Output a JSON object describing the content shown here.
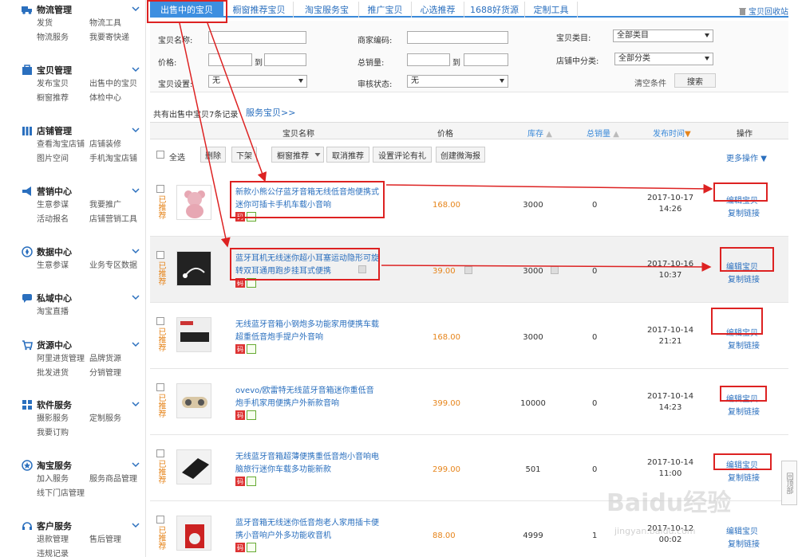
{
  "sidebar": {
    "sections": [
      {
        "title": "物流管理",
        "icon": "truck-icon",
        "links": [
          "发货",
          "物流工具",
          "物流服务",
          "我要寄快递"
        ]
      },
      {
        "title": "宝贝管理",
        "icon": "box-icon",
        "links": [
          "发布宝贝",
          "出售中的宝贝",
          "橱窗推荐",
          "体检中心"
        ]
      },
      {
        "title": "店铺管理",
        "icon": "store-icon",
        "links": [
          "查看淘宝店铺",
          "店铺装修",
          "图片空间",
          "手机淘宝店铺"
        ]
      },
      {
        "title": "营销中心",
        "icon": "megaphone-icon",
        "links": [
          "生意参谋",
          "我要推广",
          "活动报名",
          "店铺营销工具"
        ]
      },
      {
        "title": "数据中心",
        "icon": "compass-icon",
        "links": [
          "生意参谋",
          "业务专区数据"
        ]
      },
      {
        "title": "私域中心",
        "icon": "chat-icon",
        "links": [
          "淘宝直播"
        ]
      },
      {
        "title": "货源中心",
        "icon": "cart-icon",
        "links": [
          "阿里进货管理",
          "品牌货源",
          "批发进货",
          "分销管理"
        ]
      },
      {
        "title": "软件服务",
        "icon": "grid-icon",
        "links": [
          "摄影服务",
          "定制服务",
          "我要订购"
        ]
      },
      {
        "title": "淘宝服务",
        "icon": "badge-icon",
        "links": [
          "加入服务",
          "服务商品管理",
          "线下门店管理"
        ]
      },
      {
        "title": "客户服务",
        "icon": "headset-icon",
        "links": [
          "退款管理",
          "售后管理",
          "违规记录"
        ]
      }
    ]
  },
  "tabs": [
    "出售中的宝贝",
    "橱窗推荐宝贝",
    "淘宝服务宝",
    "推广宝贝",
    "心选推荐",
    "1688好货源",
    "定制工具"
  ],
  "recycle_label": "宝贝回收站",
  "filter": {
    "name_label": "宝贝名称:",
    "merchant_code_label": "商家编码:",
    "category_label": "宝贝类目:",
    "category_value": "全部类目",
    "price_label": "价格:",
    "to": "到",
    "sales_label": "总销量:",
    "shop_category_label": "店铺中分类:",
    "shop_category_value": "全部分类",
    "setting_label": "宝贝设置:",
    "setting_value": "无",
    "review_label": "审核状态:",
    "review_value": "无",
    "clear_label": "清空条件",
    "search_label": "搜索"
  },
  "summary": "共有出售中宝贝7条记录",
  "service_link": "服务宝贝>>",
  "columns": {
    "name": "宝贝名称",
    "price": "价格",
    "stock": "库存",
    "sales": "总销量",
    "time": "发布时间",
    "action": "操作"
  },
  "toolbar": {
    "select_all": "全选",
    "delete": "删除",
    "delist": "下架",
    "recommend": "橱窗推荐",
    "cancel_recommend": "取消推荐",
    "review_gift": "设置评论有礼",
    "poster": "创建微海报",
    "more": "更多操作"
  },
  "rows": [
    {
      "rec": "已推荐",
      "title": "新款小熊公仔蓝牙音箱无线低音炮便携式迷你可插卡手机车载小音响",
      "price": "168.00",
      "stock": "3000",
      "sales": "0",
      "date": "2017-10-17",
      "time": "14:26",
      "edit": "编辑宝贝",
      "copy": "复制链接",
      "badge": "码"
    },
    {
      "rec": "已推荐",
      "title": "蓝牙耳机无线迷你超小耳塞运动隐形可旋转双耳通用跑步挂耳式便携",
      "price": "39.00",
      "stock": "3000",
      "sales": "0",
      "date": "2017-10-16",
      "time": "10:37",
      "edit": "编辑宝贝",
      "copy": "复制链接",
      "badge": "码"
    },
    {
      "rec": "已推荐",
      "title": "无线蓝牙音箱小钢炮多功能家用便携车载超重低音炮手提户外音响",
      "price": "168.00",
      "stock": "3000",
      "sales": "0",
      "date": "2017-10-14",
      "time": "21:21",
      "edit": "编辑宝贝",
      "copy": "复制链接",
      "badge": "码"
    },
    {
      "rec": "已推荐",
      "title": "ovevo/欧雷特无线蓝牙音箱迷你重低音炮手机家用便携户外新款音响",
      "price": "399.00",
      "stock": "10000",
      "sales": "0",
      "date": "2017-10-14",
      "time": "14:23",
      "edit": "编辑宝贝",
      "copy": "复制链接",
      "badge": "码"
    },
    {
      "rec": "已推荐",
      "title": "无线蓝牙音箱超薄便携重低音炮小音响电脑旅行迷你车载多功能新款",
      "price": "299.00",
      "stock": "501",
      "sales": "0",
      "date": "2017-10-14",
      "time": "11:00",
      "edit": "编辑宝贝",
      "copy": "复制链接",
      "badge": "码"
    },
    {
      "rec": "已推荐",
      "title": "蓝牙音箱无线迷你低音炮老人家用插卡便携小音响户外多功能收音机",
      "price": "88.00",
      "stock": "4999",
      "sales": "1",
      "date": "2017-10-12",
      "time": "00:02",
      "edit": "编辑宝贝",
      "copy": "复制链接",
      "badge": "码"
    }
  ],
  "back_top": "回顶部",
  "watermark": "Baidu经验",
  "watermark_sub": "jingyan.baidu.com",
  "colors": {
    "accent": "#3d8fe0",
    "link": "#2a6fbe",
    "price": "#e6841a",
    "annotation": "#dd2222"
  }
}
